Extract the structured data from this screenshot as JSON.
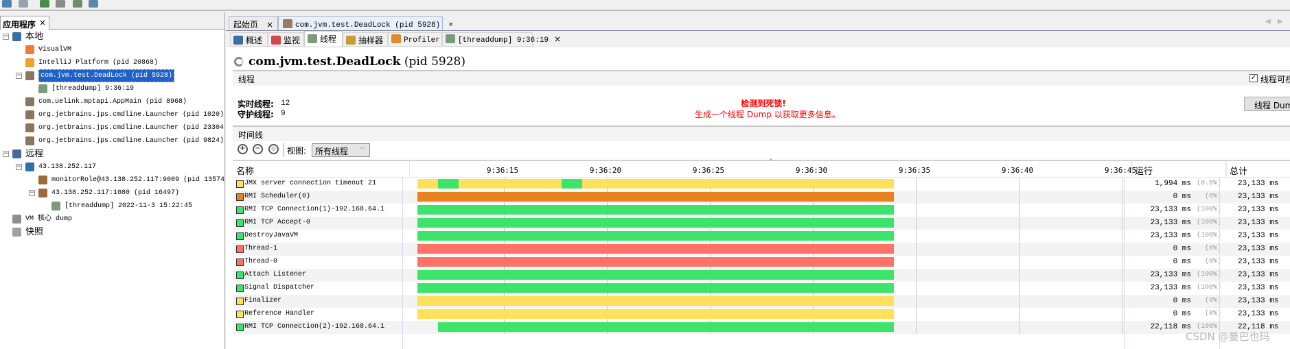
{
  "left_panel": {
    "tab_label": "应用程序",
    "tab_close": "×",
    "tree": [
      {
        "label": "本地",
        "level": 0,
        "icon": "computer-icon",
        "expander": "-"
      },
      {
        "label": "VisualVM",
        "level": 1,
        "icon": "visualvm-icon"
      },
      {
        "label": "IntelliJ Platform (pid 20868)",
        "level": 1,
        "icon": "intellij-icon"
      },
      {
        "label": "com.jvm.test.DeadLock (pid 5928)",
        "level": 1,
        "icon": "java-cup-icon",
        "expander": "-",
        "selected": true
      },
      {
        "label": "[threaddump] 9:36:19",
        "level": 2,
        "icon": "threaddump-icon"
      },
      {
        "label": "com.uelink.mptapi.AppMain (pid 8968)",
        "level": 1,
        "icon": "java-cup-icon"
      },
      {
        "label": "org.jetbrains.jps.cmdline.Launcher (pid 1020)",
        "level": 1,
        "icon": "java-cup-icon"
      },
      {
        "label": "org.jetbrains.jps.cmdline.Launcher (pid 23304",
        "level": 1,
        "icon": "java-cup-icon"
      },
      {
        "label": "org.jetbrains.jps.cmdline.Launcher (pid 9824)",
        "level": 1,
        "icon": "java-cup-icon"
      },
      {
        "label": "远程",
        "level": 0,
        "icon": "network-icon",
        "expander": "-"
      },
      {
        "label": "43.138.252.117",
        "level": 1,
        "icon": "remote-host-icon",
        "expander": "-"
      },
      {
        "label": "monitorRole@43.138.252.117:9009 (pid 13574",
        "level": 2,
        "icon": "jmx-icon"
      },
      {
        "label": "43.138.252.117:1080 (pid 16497)",
        "level": 2,
        "icon": "jmx-icon",
        "expander": "-"
      },
      {
        "label": "[threaddump] 2022-11-3 15:22:45",
        "level": 3,
        "icon": "threaddump-icon"
      },
      {
        "label": "VM 核心 dump",
        "level": 0,
        "icon": "core-dump-icon"
      },
      {
        "label": "快照",
        "level": 0,
        "icon": "snapshot-icon"
      }
    ]
  },
  "doc_tabs": [
    {
      "label": "起始页",
      "close": "×"
    },
    {
      "label": "com.jvm.test.DeadLock (pid 5928)",
      "close": "×",
      "active": true
    }
  ],
  "sub_tabs": [
    {
      "label": "概述",
      "icon": "overview-icon"
    },
    {
      "label": "监视",
      "icon": "monitor-icon"
    },
    {
      "label": "线程",
      "icon": "threads-icon",
      "active": true
    },
    {
      "label": "抽样器",
      "icon": "sampler-icon"
    },
    {
      "label": "Profiler",
      "icon": "profiler-icon"
    },
    {
      "label": "[threaddump] 9:36:19",
      "icon": "threaddump-icon",
      "close": "×"
    }
  ],
  "page_title": {
    "name": "com.jvm.test.DeadLock",
    "pid": "(pid 5928)"
  },
  "threads_section": {
    "header": "线程",
    "visualize_checkbox": {
      "label": "线程可视",
      "checked": true
    },
    "live_threads_label": "实时线程:",
    "live_threads_value": "12",
    "daemon_threads_label": "守护线程:",
    "daemon_threads_value": "9",
    "deadlock_title": "检测到死锁!",
    "deadlock_hint": "生成一个线程 Dump 以获取更多信息。",
    "dump_button": "线程 Dump"
  },
  "timeline_section": {
    "header": "时间线",
    "view_label": "视图:",
    "view_selected": "所有线程",
    "columns": {
      "name": "名称",
      "running": "运行",
      "total": "总计"
    }
  },
  "colors": {
    "running": "#3ce46a",
    "sleeping": "#fde05c",
    "park": "#e8821f",
    "monitor": "#fe7268",
    "deadlock_text": "#ff0000"
  },
  "chart_data": {
    "type": "timeline",
    "ticks": [
      "9:36:15",
      "9:36:20",
      "9:36:25",
      "9:36:30",
      "9:36:35",
      "9:36:40",
      "9:36:45"
    ],
    "threads": [
      {
        "name": "JMX server connection timeout 21",
        "color": "sleeping",
        "running": "1,994 ms",
        "running_pct": "(8.6%)",
        "total": "23,133 ms",
        "segments": [
          [
            "9:36:10.8",
            "9:36:11.8",
            "sleeping"
          ],
          [
            "9:36:11.8",
            "9:36:12.8",
            "running"
          ],
          [
            "9:36:12.8",
            "9:36:17.8",
            "sleeping"
          ],
          [
            "9:36:17.8",
            "9:36:18.8",
            "running"
          ],
          [
            "9:36:18.8",
            "9:36:33.93",
            "sleeping"
          ]
        ]
      },
      {
        "name": "RMI Scheduler(0)",
        "color": "park",
        "running": "0 ms",
        "running_pct": "(0%)",
        "total": "23,133 ms",
        "segments": [
          [
            "9:36:10.8",
            "9:36:33.93",
            "park"
          ]
        ]
      },
      {
        "name": "RMI TCP Connection(1)-192.168.64.1",
        "color": "running",
        "running": "23,133 ms",
        "running_pct": "(100%)",
        "total": "23,133 ms",
        "segments": [
          [
            "9:36:10.8",
            "9:36:33.93",
            "running"
          ]
        ]
      },
      {
        "name": "RMI TCP Accept-0",
        "color": "running",
        "running": "23,133 ms",
        "running_pct": "(100%)",
        "total": "23,133 ms",
        "segments": [
          [
            "9:36:10.8",
            "9:36:33.93",
            "running"
          ]
        ]
      },
      {
        "name": "DestroyJavaVM",
        "color": "running",
        "running": "23,133 ms",
        "running_pct": "(100%)",
        "total": "23,133 ms",
        "segments": [
          [
            "9:36:10.8",
            "9:36:33.93",
            "running"
          ]
        ]
      },
      {
        "name": "Thread-1",
        "color": "monitor",
        "running": "0 ms",
        "running_pct": "(0%)",
        "total": "23,133 ms",
        "segments": [
          [
            "9:36:10.8",
            "9:36:33.93",
            "monitor"
          ]
        ]
      },
      {
        "name": "Thread-0",
        "color": "monitor",
        "running": "0 ms",
        "running_pct": "(0%)",
        "total": "23,133 ms",
        "segments": [
          [
            "9:36:10.8",
            "9:36:33.93",
            "monitor"
          ]
        ]
      },
      {
        "name": "Attach Listener",
        "color": "running",
        "running": "23,133 ms",
        "running_pct": "(100%)",
        "total": "23,133 ms",
        "segments": [
          [
            "9:36:10.8",
            "9:36:33.93",
            "running"
          ]
        ]
      },
      {
        "name": "Signal Dispatcher",
        "color": "running",
        "running": "23,133 ms",
        "running_pct": "(100%)",
        "total": "23,133 ms",
        "segments": [
          [
            "9:36:10.8",
            "9:36:33.93",
            "running"
          ]
        ]
      },
      {
        "name": "Finalizer",
        "color": "sleeping",
        "running": "0 ms",
        "running_pct": "(0%)",
        "total": "23,133 ms",
        "segments": [
          [
            "9:36:10.8",
            "9:36:33.93",
            "sleeping"
          ]
        ]
      },
      {
        "name": "Reference Handler",
        "color": "sleeping",
        "running": "0 ms",
        "running_pct": "(0%)",
        "total": "23,133 ms",
        "segments": [
          [
            "9:36:10.8",
            "9:36:33.93",
            "sleeping"
          ]
        ]
      },
      {
        "name": "RMI TCP Connection(2)-192.168.64.1",
        "color": "running",
        "running": "22,118 ms",
        "running_pct": "(100%)",
        "total": "22,118 ms",
        "segments": [
          [
            "9:36:11.8",
            "9:36:33.93",
            "running"
          ]
        ]
      }
    ]
  },
  "watermark": "CSDN @曼巴也码"
}
